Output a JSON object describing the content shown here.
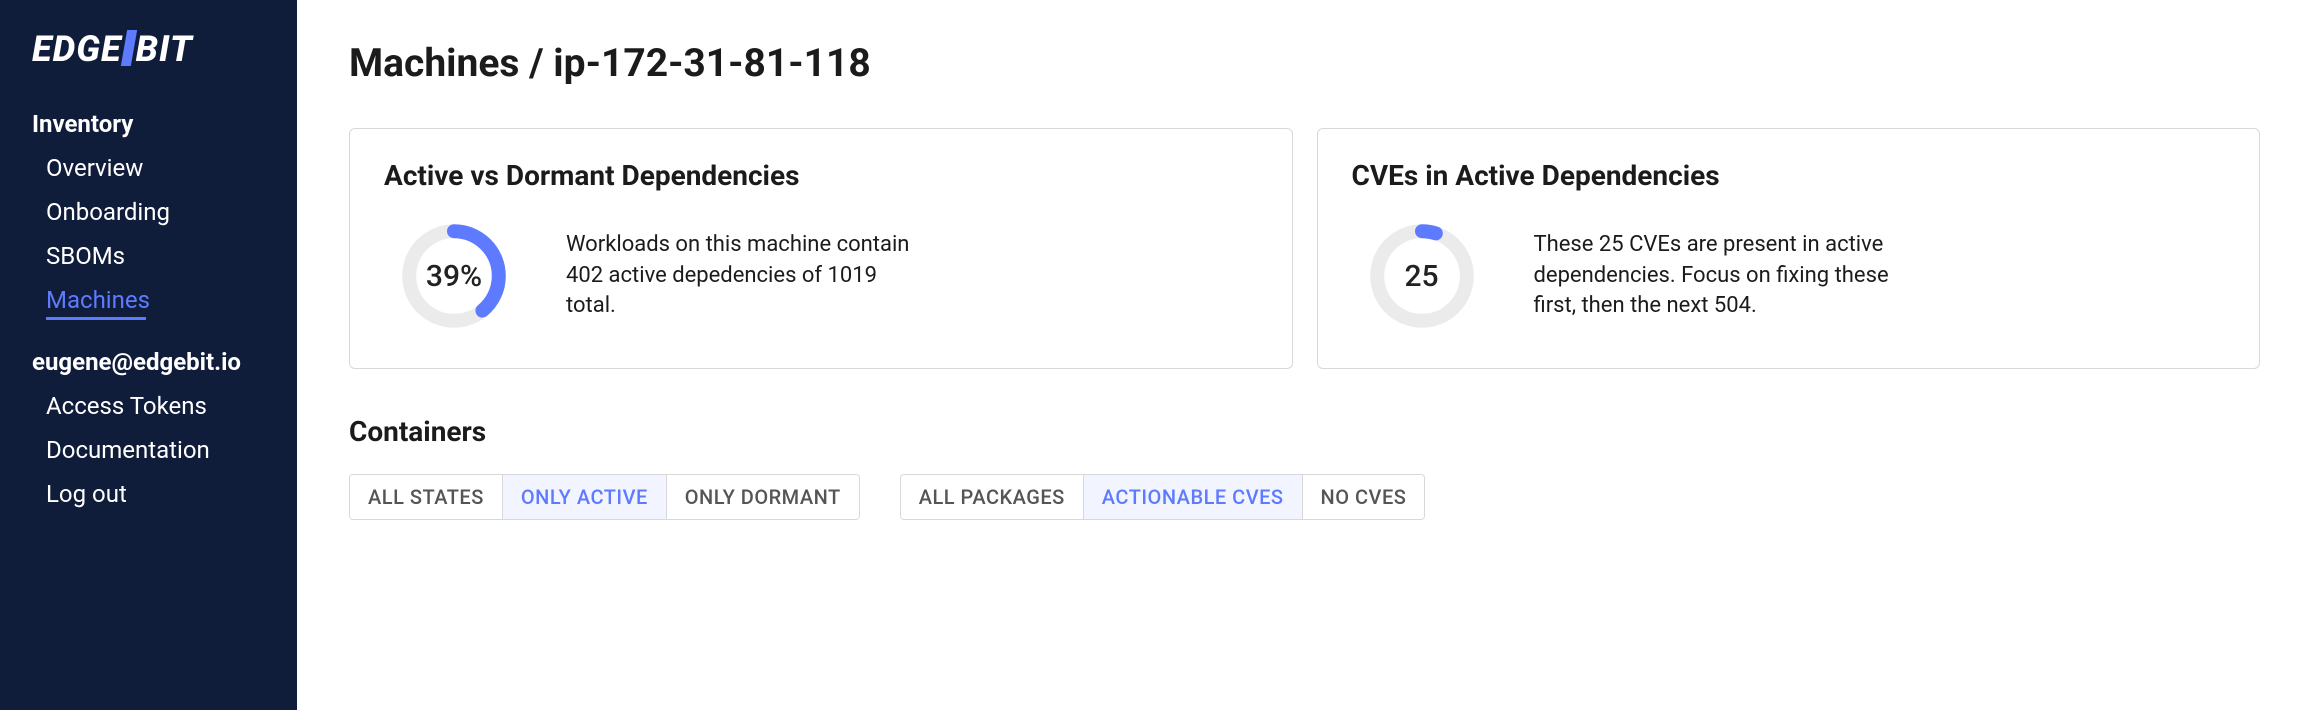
{
  "logo": {
    "left": "EDGE",
    "right": "BIT"
  },
  "sidebar": {
    "sections": [
      {
        "title": "Inventory",
        "items": [
          {
            "label": "Overview",
            "active": false
          },
          {
            "label": "Onboarding",
            "active": false
          },
          {
            "label": "SBOMs",
            "active": false
          },
          {
            "label": "Machines",
            "active": true
          }
        ]
      },
      {
        "title": "eugene@edgebit.io",
        "items": [
          {
            "label": "Access Tokens",
            "active": false
          },
          {
            "label": "Documentation",
            "active": false
          },
          {
            "label": "Log out",
            "active": false
          }
        ]
      }
    ]
  },
  "page": {
    "breadcrumb": "Machines / ip-172-31-81-118"
  },
  "cards": {
    "active_dormant": {
      "title": "Active vs Dormant Dependencies",
      "percent": 39,
      "percent_label": "39%",
      "description": "Workloads on this machine contain 402 active depedencies of 1019 total."
    },
    "cves": {
      "title": "CVEs in Active Dependencies",
      "count": 25,
      "count_label": "25",
      "percent_fill": 5,
      "description": "These 25 CVEs are present in active dependencies. Focus on fixing these first, then the next 504."
    }
  },
  "containers": {
    "heading": "Containers",
    "filter_state": {
      "options": [
        {
          "label": "ALL STATES",
          "active": false
        },
        {
          "label": "ONLY ACTIVE",
          "active": true
        },
        {
          "label": "ONLY DORMANT",
          "active": false
        }
      ]
    },
    "filter_package": {
      "options": [
        {
          "label": "ALL PACKAGES",
          "active": false
        },
        {
          "label": "ACTIONABLE CVES",
          "active": true
        },
        {
          "label": "NO CVES",
          "active": false
        }
      ]
    }
  },
  "colors": {
    "accent": "#5e7bff",
    "track": "#ebebeb"
  }
}
